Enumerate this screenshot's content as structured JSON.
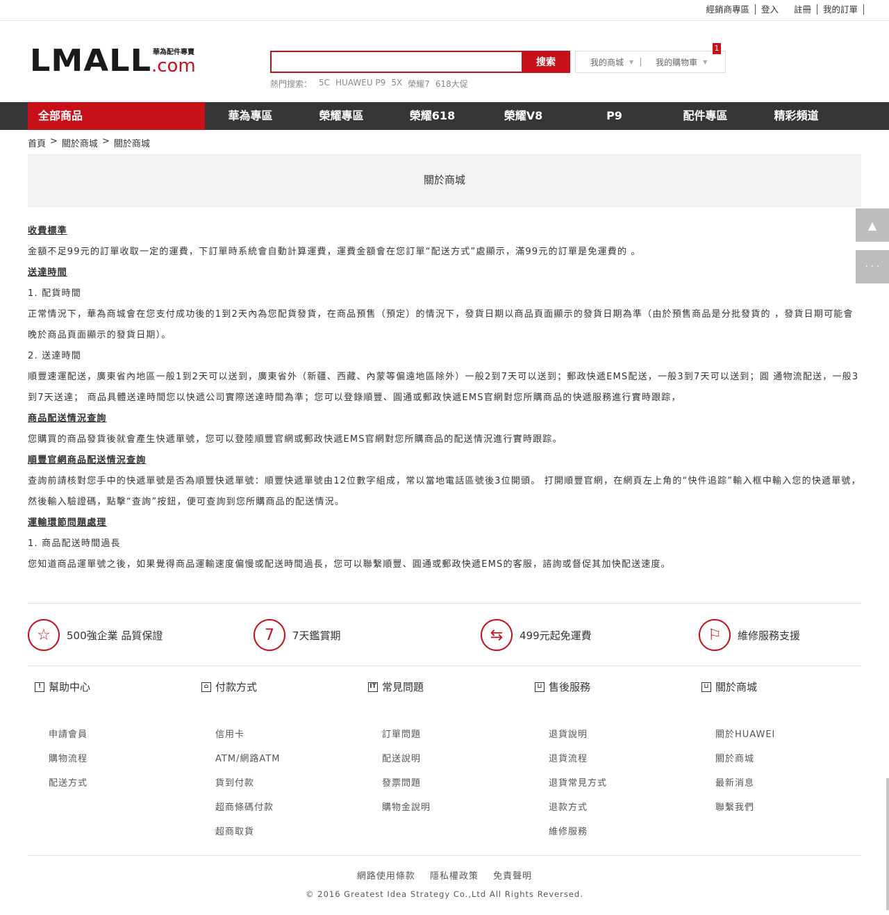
{
  "topbar": {
    "links": [
      "經銷商專區",
      "登入",
      "註冊",
      "我的訂單"
    ]
  },
  "logo": {
    "text": "LMALL",
    "slogan": "華為配件專賣",
    "dotcom": ".com"
  },
  "search": {
    "placeholder": "",
    "button": "搜索",
    "hot_label": "熱門搜索：",
    "hot_terms": [
      "5C",
      "HUAWEU P9",
      "5X",
      "榮耀7",
      "618大促"
    ]
  },
  "mall": {
    "my_mall": "我的商城",
    "my_cart": "我的購物車",
    "cart_count": "1"
  },
  "nav": {
    "all": "全部商品",
    "items": [
      "華為專區",
      "榮耀專區",
      "榮耀618",
      "榮耀V8",
      "P9",
      "配件專區",
      "精彩頻道"
    ]
  },
  "breadcrumb": [
    "首頁",
    ">",
    "關於商城",
    ">",
    "關於商城"
  ],
  "page_title": "關於商城",
  "content": [
    {
      "type": "h",
      "text": "收費標準"
    },
    {
      "type": "p",
      "text": "金額不足99元的訂單收取一定的運費，下訂單時系統會自動計算運費，運費金額會在您訂單“配送方式”處顯示，滿99元的訂單是免運費的 。"
    },
    {
      "type": "h",
      "text": "送達時間"
    },
    {
      "type": "p",
      "text": "1. 配貨時間"
    },
    {
      "type": "p",
      "text": "正常情況下，華為商城會在您支付成功後的1到2天內為您配貨發貨，在商品預售（預定）的情況下，發貨日期以商品頁面顯示的發貨日期為準（由於預售商品是分批發貨的 ，發貨日期可能會晚於商品頁面顯示的發貨日期）。"
    },
    {
      "type": "p",
      "text": "2. 送達時間"
    },
    {
      "type": "p",
      "text": "順豐速運配送，廣東省內地區一般1到2天可以送到，廣東省外（新疆、西藏、內蒙等偏遠地區除外）一般2到7天可以送到；郵政快遞EMS配送，一般3到7天可以送到；圓 通物流配送，一般3到7天送達； 商品具體送達時間您以快遞公司實際送達時間為準；您可以登錄順豐、圓通或郵政快遞EMS官網對您所購商品的快遞服務進行實時跟踪，"
    },
    {
      "type": "h",
      "text": "商品配送情況查詢"
    },
    {
      "type": "p",
      "text": "您購買的商品發貨後就會產生快遞單號，您可以登陸順豐官網或郵政快遞EMS官網對您所購商品的配送情況進行實時跟踪。"
    },
    {
      "type": "h",
      "text": "順豐官網商品配送情況查詢"
    },
    {
      "type": "p",
      "text": "查詢前請核對您手中的快遞單號是否為順豐快遞單號：順豐快遞單號由12位數字組成，常以當地電話區號後3位開頭。 打開順豐官網，在網頁左上角的“快件追踪”輸入框中輸入您的快遞單號，然後輸入驗證碼，點擊“查詢”按鈕，便可查詢到您所購商品的配送情況。"
    },
    {
      "type": "h",
      "text": "運輸環節問題處理"
    },
    {
      "type": "p",
      "text": "1. 商品配送時間過長"
    },
    {
      "type": "p",
      "text": "您知道商品運單號之後，如果覺得商品運輸速度偏慢或配送時間過長，您可以聯繫順豐、圓通或郵政快遞EMS的客服，諮詢或督促其加快配送速度。"
    }
  ],
  "features": [
    {
      "icon": "star-icon",
      "glyph": "☆",
      "text": "500強企業 品質保證"
    },
    {
      "icon": "seven-day-icon",
      "glyph": "7",
      "text": "7天鑑賞期"
    },
    {
      "icon": "free-shipping-icon",
      "glyph": "⇆",
      "text": "499元起免運費"
    },
    {
      "icon": "flag-icon",
      "glyph": "⚐",
      "text": "維修服務支援"
    }
  ],
  "footer_columns": [
    {
      "title": "幫助中心",
      "icon_glyph": "!",
      "items": [
        "申請會員",
        "購物流程",
        "配送方式"
      ]
    },
    {
      "title": "付款方式",
      "icon_glyph": "⌂",
      "items": [
        "信用卡",
        "ATM/網路ATM",
        "貨到付款",
        "超商條碼付款",
        "超商取貨"
      ]
    },
    {
      "title": "常見問題",
      "icon_glyph": "IT",
      "items": [
        "訂單問題",
        "配送說明",
        "發票問題",
        "購物金說明"
      ]
    },
    {
      "title": "售後服務",
      "icon_glyph": "⊔",
      "items": [
        "退貨說明",
        "退貨流程",
        "退貨常見方式",
        "退款方式",
        "維修服務"
      ]
    },
    {
      "title": "關於商城",
      "icon_glyph": "⊔",
      "items": [
        "關於HUAWEI",
        "關於商城",
        "最新消息",
        "聯繫我們"
      ]
    }
  ],
  "footer": {
    "links": [
      "網路使用條款",
      "隱私權政策",
      "免責聲明"
    ],
    "copyright": "© 2016 Greatest Idea Strategy Co.,Ltd All Rights Reversed."
  },
  "side": {
    "top_glyph": "▲",
    "more_glyph": "· · ·"
  },
  "colors": {
    "brand_red": "#c8101b",
    "nav_dark": "#353535"
  }
}
